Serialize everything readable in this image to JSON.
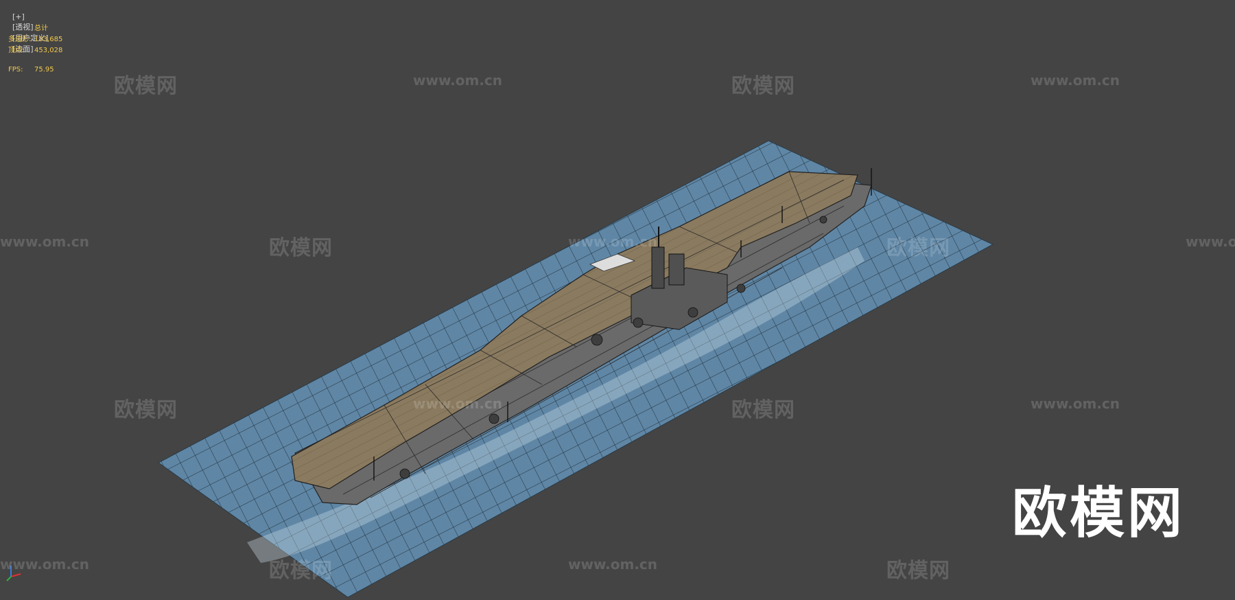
{
  "viewport": {
    "labels": [
      "[+]",
      "[透视]",
      "[用户定义]",
      "[边面]"
    ]
  },
  "stats": {
    "header": "总计",
    "polygons_label": "多边形:",
    "polygons_value": "183,685",
    "vertices_label": "顶点:",
    "vertices_value": "453,028",
    "fps_label": "FPS:",
    "fps_value": "75.95"
  },
  "watermarks": {
    "cn": "欧模网",
    "url": "www.om.cn",
    "big": "欧模网"
  },
  "colors": {
    "background": "#444444",
    "water": "#5f86a5",
    "deck": "#8a7a5f",
    "hull": "#6a6a6a",
    "stats_text": "#f2c94c"
  },
  "icons": [
    "axis-gizmo-icon"
  ]
}
